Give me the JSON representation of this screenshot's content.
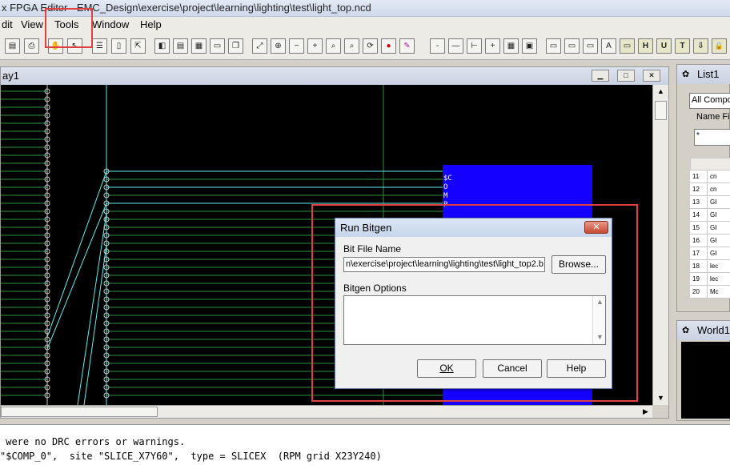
{
  "window": {
    "title": "x FPGA Editor - EMC_Design\\exercise\\project\\learning\\lighting\\test\\light_top.ncd"
  },
  "menu": {
    "items": [
      "dit",
      "View",
      "Tools",
      "Window",
      "Help"
    ]
  },
  "toolbar": {
    "buttons": [
      "save",
      "print",
      "hand",
      "select",
      "list",
      "panel",
      "grid",
      "table",
      "layers",
      "copy",
      "zoom-fit",
      "zoom-full",
      "zoom-out",
      "zoom-in",
      "zoom-select",
      "zoom-area",
      "refresh",
      "stop",
      "wrench"
    ],
    "right_labels": [
      "-",
      "—",
      "⊢",
      "+",
      "▦",
      "▣",
      "▭",
      "▭",
      "▭",
      "A",
      "▭",
      "H",
      "U",
      "T",
      "⇩",
      "🔒",
      "▦"
    ]
  },
  "array_window": {
    "title": "ay1",
    "comp_label": "$COMP"
  },
  "dialog": {
    "title": "Run Bitgen",
    "close_symbol": "✕",
    "bit_file_label": "Bit File Name",
    "bit_file_value": "n\\exercise\\project\\learning\\lighting\\test\\light_top2.b",
    "browse_label": "Browse...",
    "options_label": "Bitgen Options",
    "options_value": "",
    "ok_label": "OK",
    "cancel_label": "Cancel",
    "help_label": "Help"
  },
  "list_panel": {
    "title": "List1",
    "filter_select": "All Compo",
    "name_filter_label": "Name Fil",
    "name_filter_value": "*",
    "rows": [
      {
        "num": "11",
        "name": "cn"
      },
      {
        "num": "12",
        "name": "cn"
      },
      {
        "num": "13",
        "name": "GI"
      },
      {
        "num": "14",
        "name": "GI"
      },
      {
        "num": "15",
        "name": "GI"
      },
      {
        "num": "16",
        "name": "GI"
      },
      {
        "num": "17",
        "name": "GI"
      },
      {
        "num": "18",
        "name": "lec"
      },
      {
        "num": "19",
        "name": "lec"
      },
      {
        "num": "20",
        "name": "Mc"
      }
    ]
  },
  "world_panel": {
    "title": "World1"
  },
  "console": {
    "lines": [
      " were no DRC errors or warnings.",
      "\"$COMP_0\",  site \"SLICE_X7Y60\",  type = SLICEX  (RPM grid X23Y240)"
    ]
  },
  "colors": {
    "canvas": "#000000",
    "wire_green": "#2f8f3c",
    "wire_cyan": "#5ff0f0",
    "comp_blue": "#1400ff",
    "highlight_red": "#e04040"
  }
}
